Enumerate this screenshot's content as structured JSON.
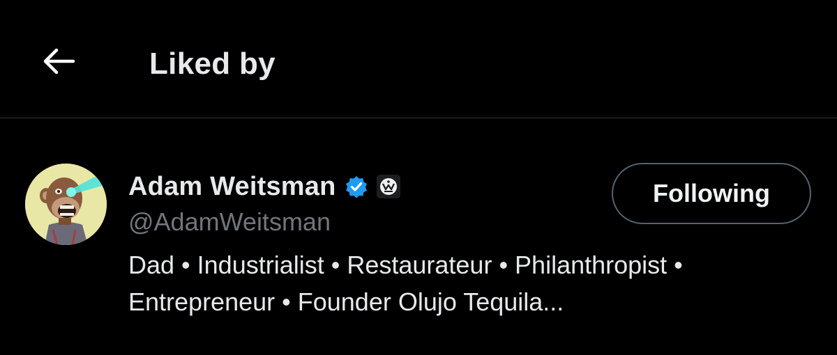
{
  "header": {
    "back_icon": "arrow-left-icon",
    "title": "Liked by"
  },
  "user": {
    "display_name": "Adam Weitsman",
    "handle": "@AdamWeitsman",
    "verified_icon": "verified-badge-icon",
    "verified_color": "#1d9bf0",
    "affiliate_icon": "affiliate-badge-icon",
    "bio": "Dad • Industrialist • Restaurateur • Philanthropist • Entrepreneur • Founder Olujo Tequila...",
    "follow_button_label": "Following"
  },
  "colors": {
    "background": "#000000",
    "primary_text": "#e7e9ea",
    "secondary_text": "#71767b",
    "divider": "#2f3336",
    "button_border": "#536471"
  }
}
